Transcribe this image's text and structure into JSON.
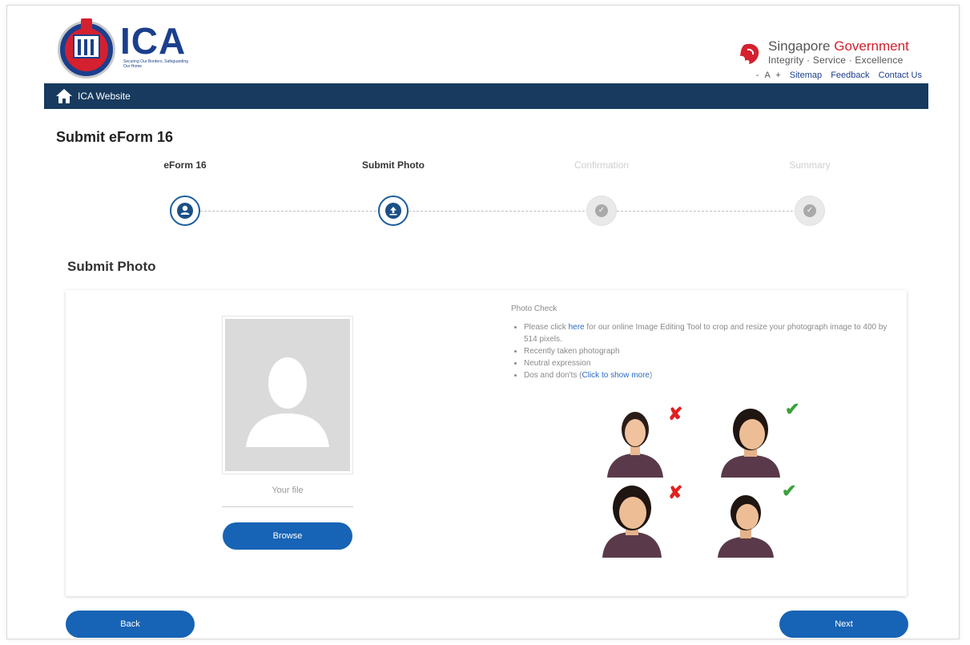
{
  "header": {
    "logo_text": "ICA",
    "logo_tagline": "Securing Our Borders, Safeguarding Our Home",
    "gov_title_part1": "Singapore",
    "gov_title_part2": "Government",
    "gov_values": "Integrity · Service · Excellence",
    "font_decrease": "-",
    "font_label": "A",
    "font_increase": "+",
    "links": [
      "Sitemap",
      "Feedback",
      "Contact Us"
    ]
  },
  "navbar": {
    "home_label": "ICA Website"
  },
  "page_title": "Submit eForm 16",
  "steps": [
    {
      "label": "eForm 16",
      "state": "active",
      "icon": "person-icon"
    },
    {
      "label": "Submit Photo",
      "state": "active",
      "icon": "upload-icon"
    },
    {
      "label": "Confirmation",
      "state": "inactive",
      "icon": "check-icon"
    },
    {
      "label": "Summary",
      "state": "inactive",
      "icon": "check-icon"
    }
  ],
  "section_title": "Submit Photo",
  "upload": {
    "your_file_label": "Your file",
    "browse_label": "Browse"
  },
  "photo_check": {
    "heading": "Photo Check",
    "item1_pre": "Please click ",
    "item1_link": "here",
    "item1_post": " for our online Image Editing Tool to crop and resize your photograph image to 400 by 514 pixels.",
    "item2": "Recently taken photograph",
    "item3": "Neutral expression",
    "item4_pre": "Dos and don'ts (",
    "item4_link": "Click to show more",
    "item4_post": ")"
  },
  "samples": [
    {
      "mark": "✘",
      "type": "bad"
    },
    {
      "mark": "✔",
      "type": "good"
    },
    {
      "mark": "✘",
      "type": "bad"
    },
    {
      "mark": "✔",
      "type": "good"
    }
  ],
  "buttons": {
    "back_label": "Back",
    "next_label": "Next"
  },
  "colors": {
    "brand_blue": "#1b3f8c",
    "navbar": "#173a5e",
    "button": "#1763b5",
    "gov_red": "#d4202f"
  }
}
